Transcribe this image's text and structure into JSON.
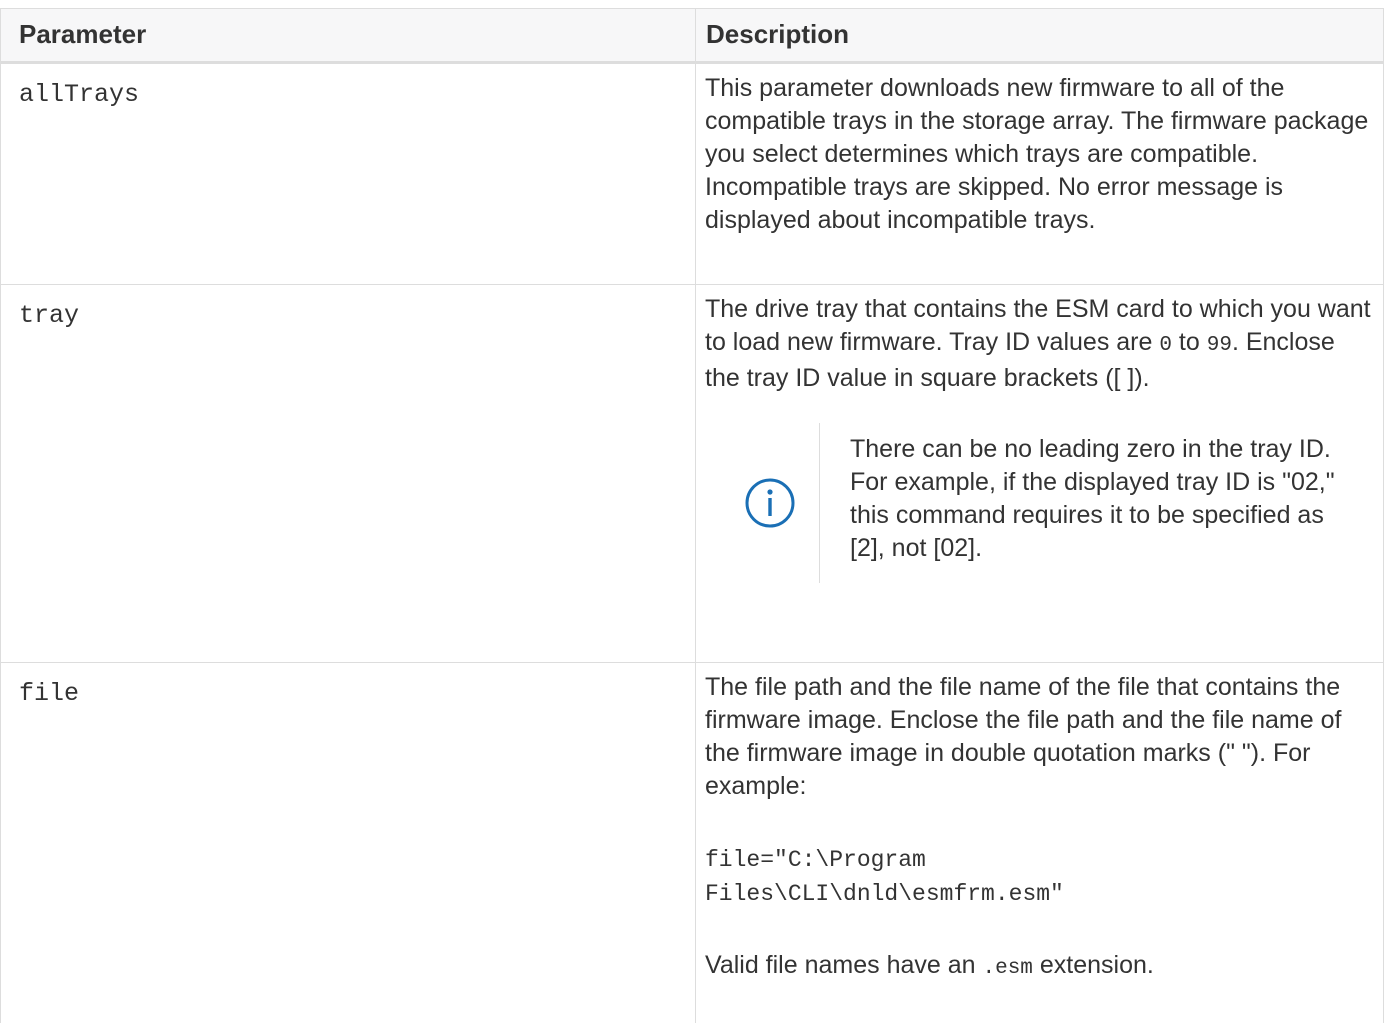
{
  "header": {
    "param_label": "Parameter",
    "desc_label": "Description"
  },
  "rows": [
    {
      "param": "allTrays",
      "desc": "This parameter downloads new firmware to all of the compatible trays in the storage array. The firmware package you select determines which trays are compatible. Incompatible trays are skipped. No error message is displayed about incompatible trays."
    },
    {
      "param": "tray",
      "desc_part1": "The drive tray that contains the ESM card to which you want to load new firmware. Tray ID values are ",
      "desc_code1": "0",
      "desc_part2": " to ",
      "desc_code2": "99",
      "desc_part3": ". Enclose the tray ID value in square brackets ([ ]).",
      "note_icon": "info-circle-icon",
      "note": "There can be no leading zero in the tray ID. For example, if the displayed tray ID is \"02,\" this command requires it to be specified as [2], not [02]."
    },
    {
      "param": "file",
      "desc": "The file path and the file name of the file that contains the firmware image. Enclose the file path and the file name of the firmware image in double quotation marks (\" \"). For example:",
      "example_line1": "file=\"C:\\Program",
      "example_line2": "Files\\CLI\\dnld\\esmfrm.esm\"",
      "valid_part1": "Valid file names have an ",
      "valid_code": ".esm",
      "valid_part2": " extension."
    }
  ],
  "colors": {
    "border": "#dddddd",
    "header_bg": "#f7f7f8",
    "text": "#333333",
    "icon": "#1a6fb5"
  }
}
